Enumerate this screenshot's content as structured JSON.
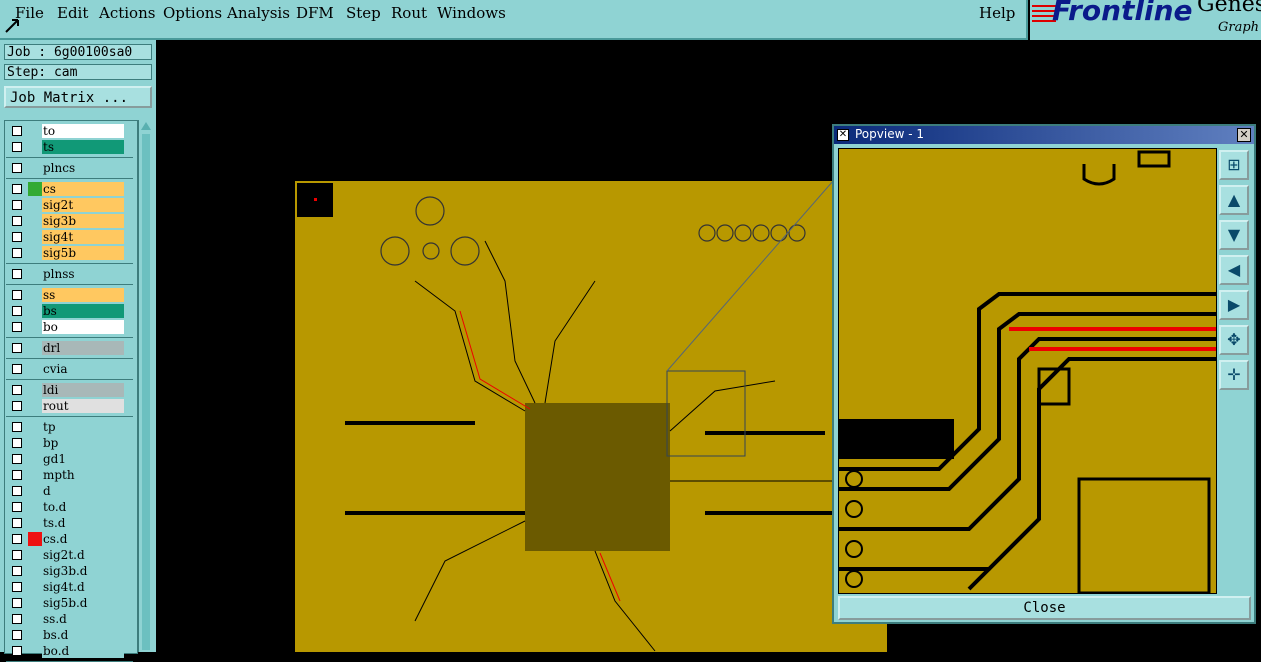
{
  "menubar": {
    "items": [
      "File",
      "Edit",
      "Actions",
      "Options",
      "Analysis",
      "DFM",
      "Step",
      "Rout",
      "Windows"
    ],
    "help": "Help"
  },
  "logo": {
    "brand": "Frontline",
    "product": "Genes",
    "tagline": "Graph"
  },
  "job": {
    "label": "Job : 6g00100sa0",
    "step": "Step: cam",
    "matrix_button": "Job Matrix ..."
  },
  "layers": [
    {
      "name": "to",
      "fill": "#ffffff"
    },
    {
      "name": "ts",
      "fill": "#119977"
    },
    {
      "name": "plncs",
      "fill": "#8fd3d3"
    },
    {
      "name": "cs",
      "fill": "#ffc860",
      "color": "#33aa33"
    },
    {
      "name": "sig2t",
      "fill": "#ffc860"
    },
    {
      "name": "sig3b",
      "fill": "#ffc860"
    },
    {
      "name": "sig4t",
      "fill": "#ffc860"
    },
    {
      "name": "sig5b",
      "fill": "#ffc860"
    },
    {
      "name": "plnss",
      "fill": "#8fd3d3"
    },
    {
      "name": "ss",
      "fill": "#ffc860"
    },
    {
      "name": "bs",
      "fill": "#119977"
    },
    {
      "name": "bo",
      "fill": "#ffffff"
    },
    {
      "name": "drl",
      "fill": "#a8b8b8"
    },
    {
      "name": "cvia",
      "fill": "#8fd3d3"
    },
    {
      "name": "ldi",
      "fill": "#a8b8b8"
    },
    {
      "name": "rout",
      "fill": "#e0e0e0"
    },
    {
      "name": "tp",
      "fill": "#8fd3d3"
    },
    {
      "name": "bp",
      "fill": "#8fd3d3"
    },
    {
      "name": "gd1",
      "fill": "#8fd3d3"
    },
    {
      "name": "mpth",
      "fill": "#8fd3d3"
    },
    {
      "name": "d",
      "fill": "#8fd3d3"
    },
    {
      "name": "to.d",
      "fill": "#8fd3d3"
    },
    {
      "name": "ts.d",
      "fill": "#8fd3d3"
    },
    {
      "name": "cs.d",
      "fill": "#8fd3d3",
      "color": "#ee1111"
    },
    {
      "name": "sig2t.d",
      "fill": "#8fd3d3"
    },
    {
      "name": "sig3b.d",
      "fill": "#8fd3d3"
    },
    {
      "name": "sig4t.d",
      "fill": "#8fd3d3"
    },
    {
      "name": "sig5b.d",
      "fill": "#8fd3d3"
    },
    {
      "name": "ss.d",
      "fill": "#8fd3d3"
    },
    {
      "name": "bs.d",
      "fill": "#8fd3d3"
    },
    {
      "name": "bo.d",
      "fill": "#8fd3d3"
    }
  ],
  "popview": {
    "title": "Popview - 1",
    "close_label": "Close",
    "tools": [
      "zoom-in-icon",
      "pan-up-icon",
      "pan-down-icon",
      "pan-left-icon",
      "pan-right-icon",
      "fit-icon",
      "center-icon"
    ]
  },
  "colors": {
    "board": "#b89800",
    "panel": "#8fd3d3",
    "trace": "#000000",
    "highlight": "#ee1111"
  }
}
